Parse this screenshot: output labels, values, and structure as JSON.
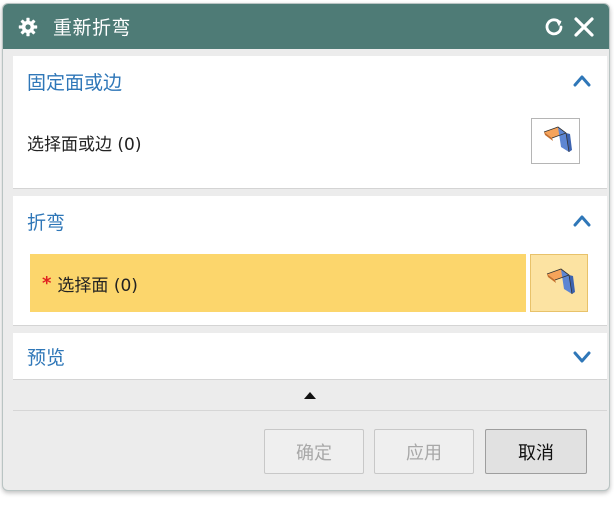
{
  "dialog": {
    "title": "重新折弯",
    "icons": {
      "title": "gear-icon",
      "reset": "reset-icon",
      "close": "close-icon"
    }
  },
  "groups": {
    "fixed": {
      "label": "固定面或边",
      "expanded": true,
      "select_label": "选择面或边 (0)",
      "select_icon": "face-select-icon"
    },
    "bend": {
      "label": "折弯",
      "expanded": true,
      "required_marker": "*",
      "select_label": "选择面 (0)",
      "select_icon": "face-select-icon",
      "highlight_color": "#fcd66c"
    },
    "preview": {
      "label": "预览",
      "expanded": false
    }
  },
  "footer": {
    "collapse_icon": "triangle-up-icon",
    "ok_label": "确定",
    "apply_label": "应用",
    "cancel_label": "取消"
  },
  "colors": {
    "titlebar": "#4e7b76",
    "group_label": "#2f77b8",
    "accent_chevron": "#2f77b8"
  }
}
